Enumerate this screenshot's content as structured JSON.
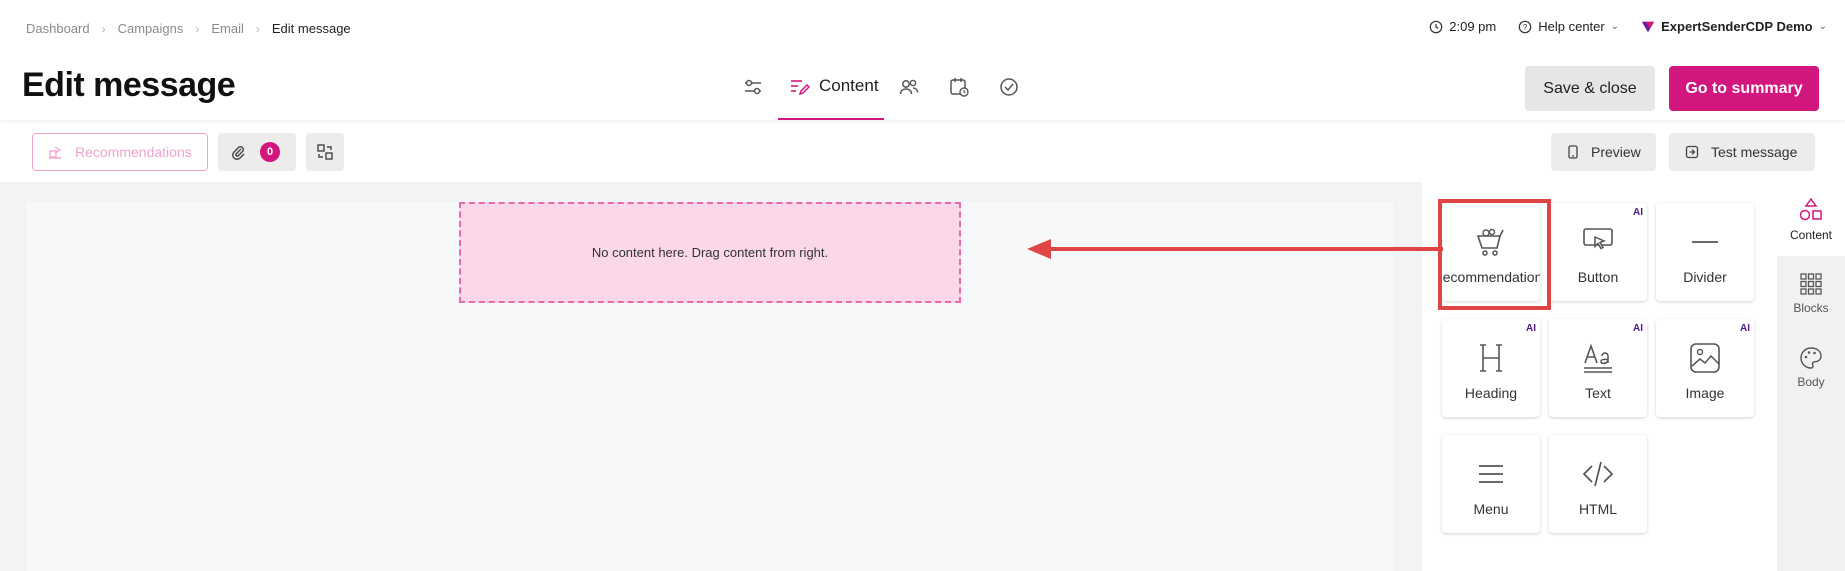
{
  "breadcrumb": [
    "Dashboard",
    "Campaigns",
    "Email",
    "Edit message"
  ],
  "top_right": {
    "time": "2:09 pm",
    "help": "Help center",
    "account": "ExpertSenderCDP Demo"
  },
  "page_title": "Edit message",
  "steps": {
    "active_label": "Content"
  },
  "buttons": {
    "save_close": "Save & close",
    "go_summary": "Go to summary"
  },
  "toolbar": {
    "recommendations": "Recommendations",
    "attachments_count": "0",
    "preview": "Preview",
    "test_message": "Test message"
  },
  "canvas": {
    "empty_text": "No content here. Drag content from right."
  },
  "tiles": [
    {
      "label": "Recommendations",
      "icon": "basket-icon",
      "ai": ""
    },
    {
      "label": "Button",
      "icon": "pointer-icon",
      "ai": "AI"
    },
    {
      "label": "Divider",
      "icon": "divider-icon",
      "ai": ""
    },
    {
      "label": "Heading",
      "icon": "heading-icon",
      "ai": "AI"
    },
    {
      "label": "Text",
      "icon": "text-icon",
      "ai": "AI"
    },
    {
      "label": "Image",
      "icon": "image-icon",
      "ai": "AI"
    },
    {
      "label": "Menu",
      "icon": "menu-icon",
      "ai": ""
    },
    {
      "label": "HTML",
      "icon": "code-icon",
      "ai": ""
    }
  ],
  "side_tabs": [
    "Content",
    "Blocks",
    "Body"
  ],
  "colors": {
    "accent": "#d3157e",
    "annotation": "#e04545",
    "ai_badge": "#4b1c8a"
  }
}
